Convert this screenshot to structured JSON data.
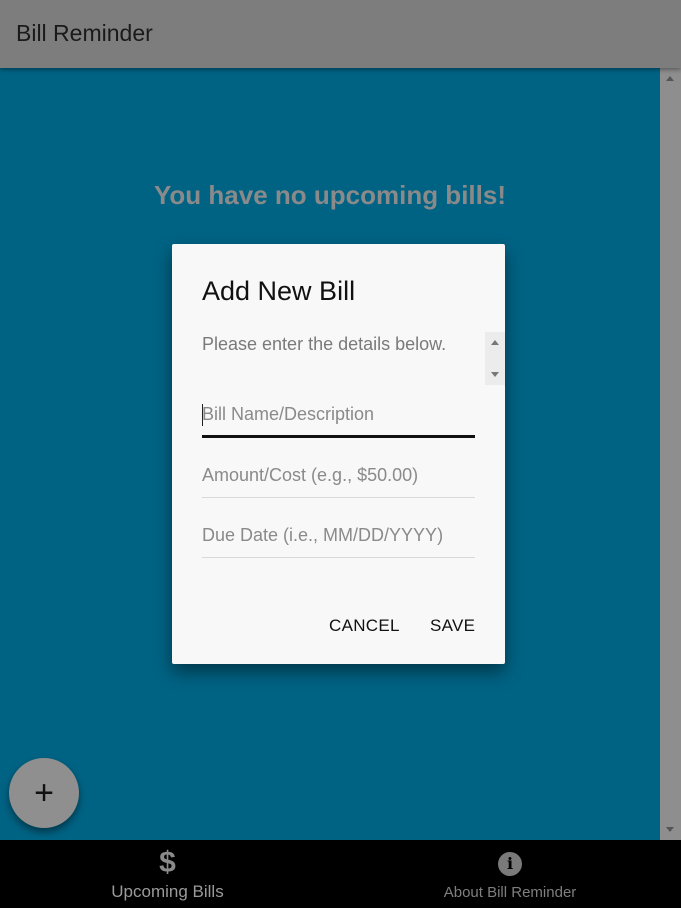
{
  "app": {
    "title": "Bill Reminder"
  },
  "main": {
    "empty_message": "You have no upcoming bills!"
  },
  "dialog": {
    "title": "Add New Bill",
    "text": "Please enter the details below.",
    "fields": [
      {
        "placeholder": "Bill Name/Description",
        "value": ""
      },
      {
        "placeholder": "Amount/Cost (e.g., $50.00)",
        "value": ""
      },
      {
        "placeholder": "Due Date (i.e., MM/DD/YYYY)",
        "value": ""
      }
    ],
    "cancel_label": "CANCEL",
    "save_label": "SAVE"
  },
  "fab": {
    "icon": "plus-icon",
    "glyph": "+"
  },
  "bottom_nav": {
    "items": [
      {
        "label": "Upcoming Bills",
        "icon": "dollar-icon",
        "glyph": "$",
        "active": true
      },
      {
        "label": "About Bill Reminder",
        "icon": "info-icon",
        "glyph": "i",
        "active": false
      }
    ]
  },
  "colors": {
    "content_bg": "#006384",
    "appbar_bg": "#7d7d7d",
    "dialog_bg": "#f8f8f8",
    "nav_bg": "#000000"
  }
}
